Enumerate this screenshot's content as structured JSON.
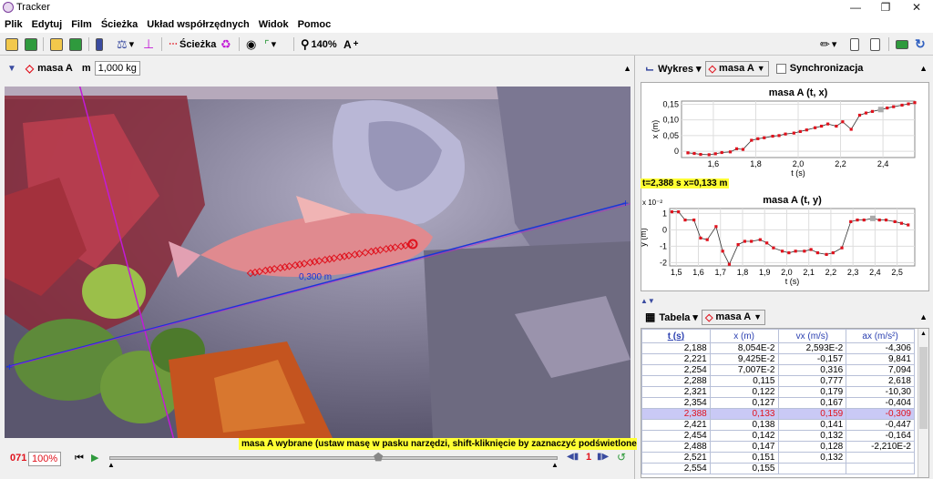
{
  "window": {
    "title": "Tracker"
  },
  "menu": [
    "Plik",
    "Edytuj",
    "Film",
    "Ścieżka",
    "Układ współrzędnych",
    "Widok",
    "Pomoc"
  ],
  "toolbar": {
    "track_label": "Ścieżka",
    "zoom": "140%"
  },
  "trackbar": {
    "track_name": "masa A",
    "mass_label": "m",
    "mass_value": "1,000 kg"
  },
  "video": {
    "calibration_label": "0,300 m",
    "track_color": "#e0121d",
    "axis_color": "#1a35d8",
    "calib_color": "#c21bd6"
  },
  "status_message": "masa A wybrane (ustaw masę w pasku narzędzi, shift-kliknięcie by zaznaczyć podświetlone pozycje)",
  "playbar": {
    "frame": "071",
    "speed": "100%",
    "step": "1"
  },
  "plot_panel": {
    "view_label": "Wykres",
    "track_label": "masa A",
    "sync_label": "Synchronizacja"
  },
  "readout": "t=2,388 s  x=0,133 m",
  "chart_data": [
    {
      "type": "line",
      "title": "masa A (t, x)",
      "xlabel": "t (s)",
      "ylabel": "x (m)",
      "xlim": [
        1.45,
        2.55
      ],
      "ylim": [
        -0.02,
        0.16
      ],
      "xticks": [
        "1,6",
        "1,8",
        "2,0",
        "2,2",
        "2,4"
      ],
      "yticks": [
        "0",
        "0,05",
        "0,10",
        "0,15"
      ],
      "grid": true,
      "series": [
        {
          "x": [
            1.48,
            1.51,
            1.54,
            1.58,
            1.61,
            1.64,
            1.68,
            1.71,
            1.74,
            1.78,
            1.81,
            1.84,
            1.88,
            1.91,
            1.94,
            1.98,
            2.01,
            2.04,
            2.08,
            2.11,
            2.14,
            2.18,
            2.21,
            2.25,
            2.29,
            2.32,
            2.35,
            2.39,
            2.42,
            2.45,
            2.49,
            2.52,
            2.55
          ],
          "y": [
            -0.005,
            -0.007,
            -0.01,
            -0.011,
            -0.008,
            -0.004,
            -0.002,
            0.008,
            0.006,
            0.035,
            0.04,
            0.043,
            0.048,
            0.05,
            0.055,
            0.058,
            0.063,
            0.068,
            0.075,
            0.08,
            0.087,
            0.08,
            0.094,
            0.07,
            0.115,
            0.122,
            0.127,
            0.133,
            0.138,
            0.142,
            0.147,
            0.151,
            0.155
          ]
        }
      ]
    },
    {
      "type": "line",
      "title": "masa A (t, y)",
      "xlabel": "t (s)",
      "ylabel": "y (m)",
      "y_multiplier": "x 10⁻²",
      "xlim": [
        1.47,
        2.58
      ],
      "ylim": [
        -2.2,
        1.3
      ],
      "xticks": [
        "1,5",
        "1,6",
        "1,7",
        "1,8",
        "1,9",
        "2,0",
        "2,1",
        "2,2",
        "2,3",
        "2,4",
        "2,5"
      ],
      "yticks": [
        "1",
        "0",
        "-1",
        "-2"
      ],
      "grid": true,
      "series": [
        {
          "x": [
            1.48,
            1.51,
            1.54,
            1.58,
            1.61,
            1.64,
            1.68,
            1.71,
            1.74,
            1.78,
            1.81,
            1.84,
            1.88,
            1.91,
            1.94,
            1.98,
            2.01,
            2.04,
            2.08,
            2.11,
            2.14,
            2.18,
            2.21,
            2.25,
            2.29,
            2.32,
            2.35,
            2.39,
            2.42,
            2.45,
            2.49,
            2.52,
            2.55
          ],
          "y": [
            1.1,
            1.1,
            0.6,
            0.6,
            -0.5,
            -0.6,
            0.2,
            -1.3,
            -2.1,
            -0.9,
            -0.7,
            -0.7,
            -0.6,
            -0.8,
            -1.1,
            -1.3,
            -1.4,
            -1.3,
            -1.3,
            -1.2,
            -1.4,
            -1.5,
            -1.4,
            -1.1,
            0.5,
            0.6,
            0.6,
            0.7,
            0.6,
            0.6,
            0.5,
            0.4,
            0.3
          ]
        }
      ]
    }
  ],
  "table_panel": {
    "view_label": "Tabela",
    "track_label": "masa A"
  },
  "table": {
    "headers": [
      "t (s)",
      "x (m)",
      "vx (m/s)",
      "ax (m/s²)"
    ],
    "rows": [
      [
        "2,188",
        "8,054E-2",
        "2,593E-2",
        "-4,306"
      ],
      [
        "2,221",
        "9,425E-2",
        "-0,157",
        "9,841"
      ],
      [
        "2,254",
        "7,007E-2",
        "0,316",
        "7,094"
      ],
      [
        "2,288",
        "0,115",
        "0,777",
        "2,618"
      ],
      [
        "2,321",
        "0,122",
        "0,179",
        "-10,30"
      ],
      [
        "2,354",
        "0,127",
        "0,167",
        "-0,404"
      ],
      [
        "2,388",
        "0,133",
        "0,159",
        "-0,309"
      ],
      [
        "2,421",
        "0,138",
        "0,141",
        "-0,447"
      ],
      [
        "2,454",
        "0,142",
        "0,132",
        "-0,164"
      ],
      [
        "2,488",
        "0,147",
        "0,128",
        "-2,210E-2"
      ],
      [
        "2,521",
        "0,151",
        "0,132",
        ""
      ],
      [
        "2,554",
        "0,155",
        "",
        ""
      ]
    ],
    "selected_row": 6
  }
}
